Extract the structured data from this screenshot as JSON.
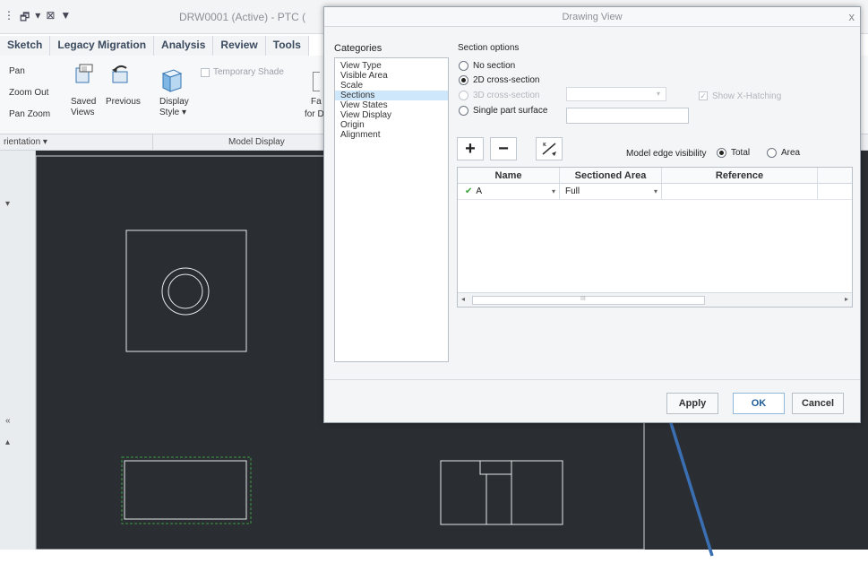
{
  "app": {
    "title": "DRW0001 (Active) - PTC (",
    "qat_symbols": [
      "⋮",
      "🗗",
      "▾",
      "⊠",
      "▼"
    ]
  },
  "tabs": [
    "Sketch",
    "Legacy Migration",
    "Analysis",
    "Review",
    "Tools"
  ],
  "ribbon": {
    "pan": "Pan",
    "zoom_out": "Zoom Out",
    "pan_zoom": "Pan Zoom",
    "saved_views": "Saved\nViews",
    "previous": "Previous",
    "display_style": "Display\nStyle ▾",
    "temporary_shade": "Temporary Shade",
    "fa": "Fa",
    "for": "for D",
    "groups": {
      "orientation": "rientation ▾",
      "model_display": "Model Display"
    }
  },
  "dialog": {
    "title": "Drawing View",
    "close": "x",
    "categories_label": "Categories",
    "categories": [
      "View Type",
      "Visible Area",
      "Scale",
      "Sections",
      "View States",
      "View Display",
      "Origin",
      "Alignment"
    ],
    "selected_category": "Sections",
    "section_options_label": "Section options",
    "options": {
      "no_section": "No section",
      "cross_2d": "2D cross-section",
      "cross_3d": "3D cross-section",
      "single_part": "Single part surface"
    },
    "selected_option": "2D cross-section",
    "show_x_hatching": "Show X-Hatching",
    "model_edge_visibility": "Model edge visibility",
    "visibility_total": "Total",
    "visibility_area": "Area",
    "table": {
      "headers": [
        "Name",
        "Sectioned Area",
        "Reference"
      ],
      "rows": [
        {
          "name": "A",
          "sectioned_area": "Full",
          "reference": ""
        }
      ],
      "scroll_label": "III"
    },
    "buttons": {
      "apply": "Apply",
      "ok": "OK",
      "cancel": "Cancel"
    }
  },
  "left_pane_symbols": [
    "▾",
    "«",
    "▴"
  ],
  "colors": {
    "canvas": "#2a2e33",
    "selection_green": "#3f9b3f",
    "arrow": "#3b6fb3",
    "accent": "#1d5c99"
  }
}
